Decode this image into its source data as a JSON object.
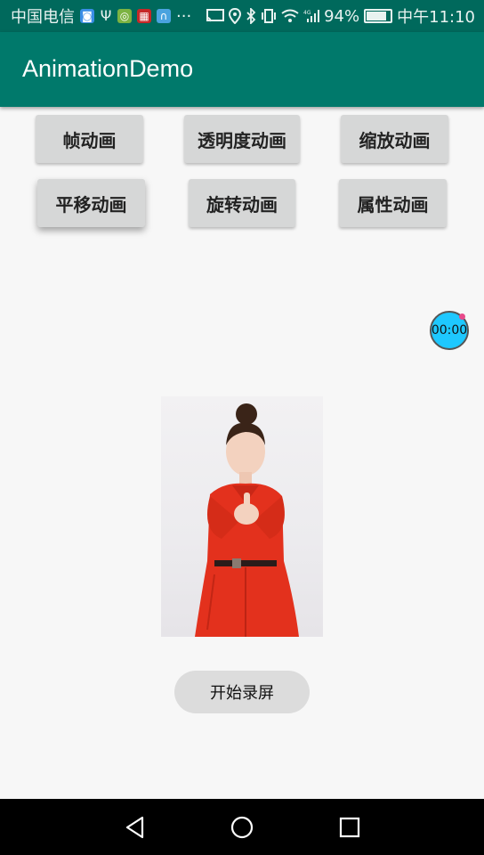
{
  "status_bar": {
    "carrier": "中国电信",
    "icons": [
      "app-icon-1",
      "usb-icon",
      "app-icon-2",
      "app-icon-3",
      "app-icon-4",
      "more-icon"
    ],
    "overflow": "···",
    "battery_pct": "94%",
    "time": "中午11:10"
  },
  "app_bar": {
    "title": "AnimationDemo",
    "color": "#00796b"
  },
  "buttons": {
    "frame": "帧动画",
    "alpha": "透明度动画",
    "scale": "缩放动画",
    "translate": "平移动画",
    "rotate": "旋转动画",
    "property": "属性动画"
  },
  "timer": {
    "label": "00:00",
    "color": "#1ec8ff"
  },
  "record_button": {
    "label": "开始录屏"
  },
  "nav_bar": {
    "icons": [
      "back-icon",
      "home-icon",
      "recents-icon"
    ]
  }
}
